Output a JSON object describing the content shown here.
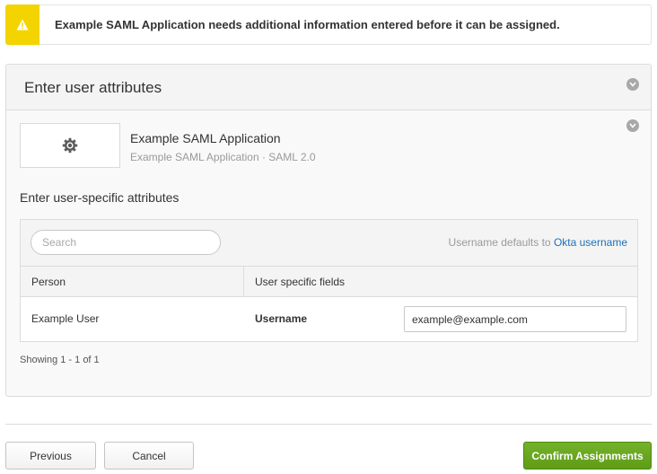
{
  "alert": {
    "icon": "warning-icon",
    "accent_color": "#f3d400",
    "message": "Example SAML Application needs additional information entered before it can be assigned."
  },
  "panel": {
    "title": "Enter user attributes",
    "app": {
      "logo_icon": "gear-icon",
      "name": "Example SAML Application",
      "subtitle": "Example SAML Application · SAML 2.0"
    },
    "section_label": "Enter user-specific attributes",
    "grid": {
      "search_placeholder": "Search",
      "defaults_prefix": "Username defaults to",
      "defaults_link": "Okta username",
      "columns": [
        "Person",
        "User specific fields"
      ],
      "rows": [
        {
          "person": "Example User",
          "field_label": "Username",
          "field_value": "example@example.com"
        }
      ]
    },
    "showing": "Showing 1 - 1 of 1"
  },
  "footer": {
    "previous_label": "Previous",
    "cancel_label": "Cancel",
    "confirm_label": "Confirm Assignments",
    "confirm_color": "#6aa81f"
  }
}
